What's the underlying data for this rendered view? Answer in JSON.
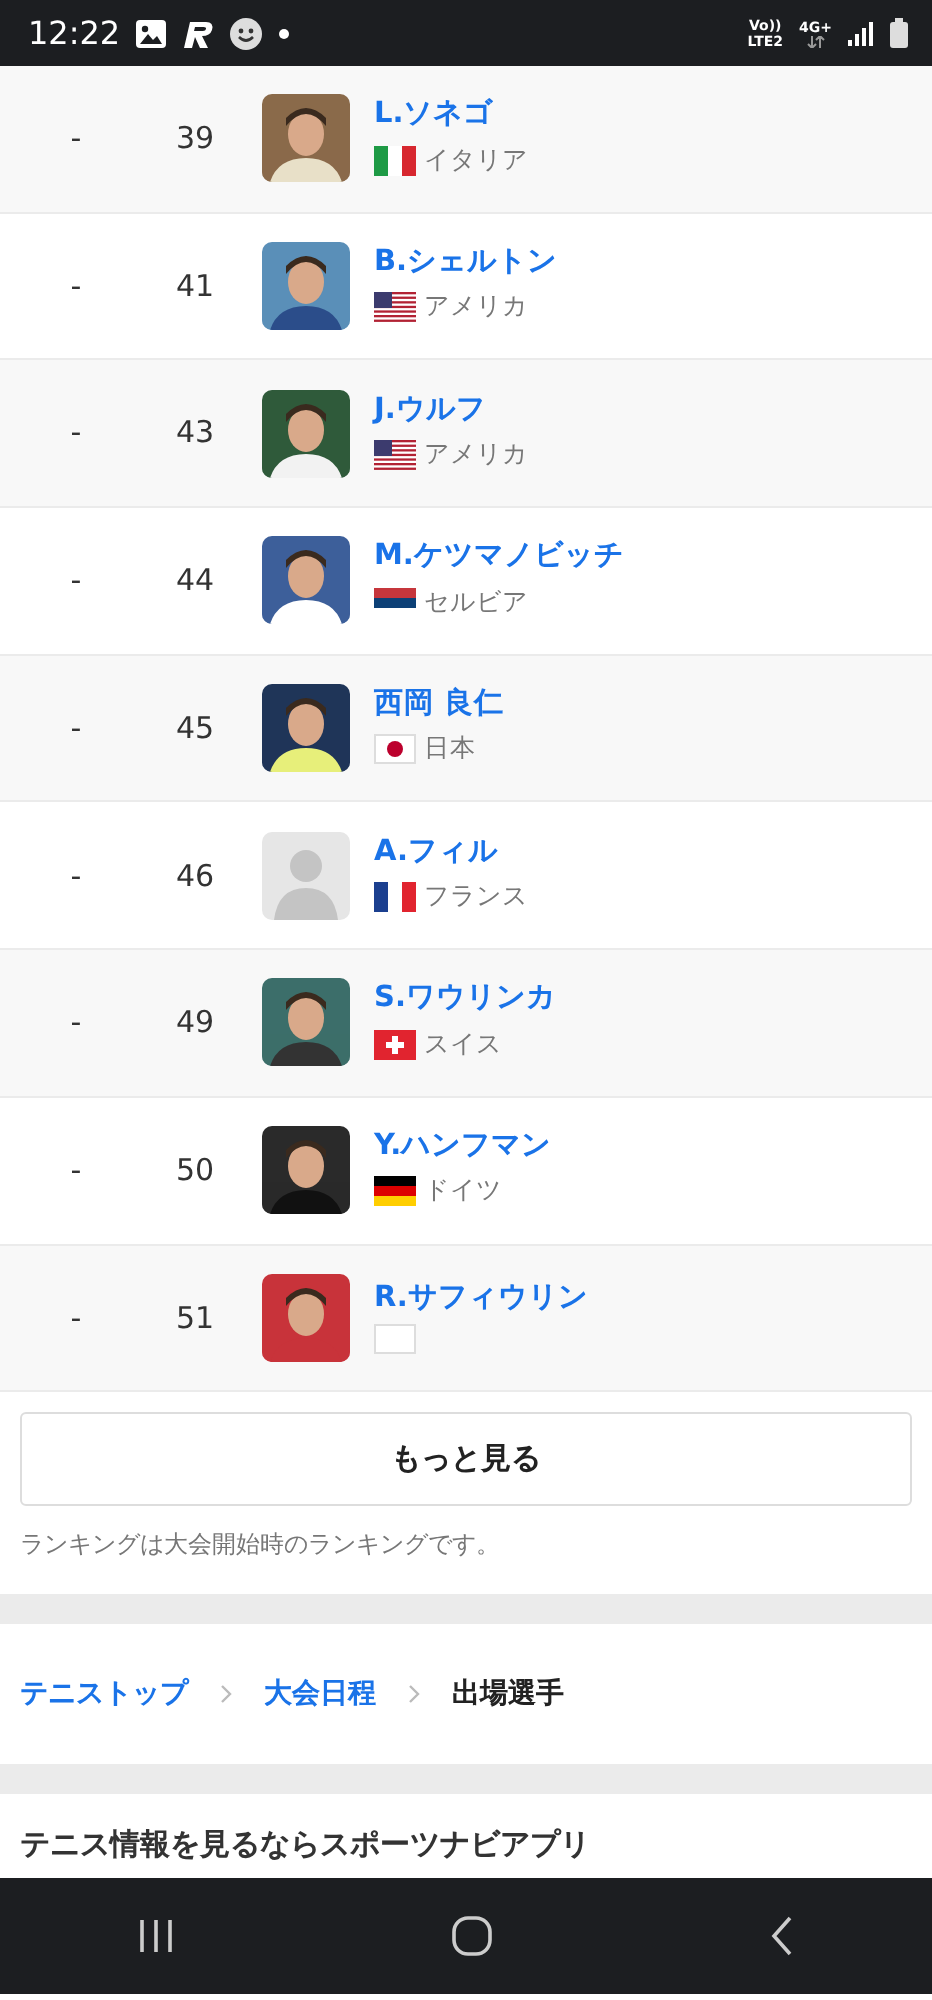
{
  "status_bar": {
    "time": "12:22",
    "volte_top": "Vo))",
    "volte_bottom": "LTE2",
    "network": "4G+"
  },
  "players": [
    {
      "change": "-",
      "rank": "39",
      "name": "L.ソネゴ",
      "country": "イタリア"
    },
    {
      "change": "-",
      "rank": "41",
      "name": "B.シェルトン",
      "country": "アメリカ"
    },
    {
      "change": "-",
      "rank": "43",
      "name": "J.ウルフ",
      "country": "アメリカ"
    },
    {
      "change": "-",
      "rank": "44",
      "name": "M.ケツマノビッチ",
      "country": "セルビア"
    },
    {
      "change": "-",
      "rank": "45",
      "name": "西岡 良仁",
      "country": "日本"
    },
    {
      "change": "-",
      "rank": "46",
      "name": "A.フィル",
      "country": "フランス",
      "photo": {
        "kind": "placeholder"
      }
    },
    {
      "change": "-",
      "rank": "49",
      "name": "S.ワウリンカ",
      "country": "スイス"
    },
    {
      "change": "-",
      "rank": "50",
      "name": "Y.ハンフマン",
      "country": "ドイツ"
    },
    {
      "change": "-",
      "rank": "51",
      "name": "R.サフィウリン"
    }
  ],
  "more_button": "もっと見る",
  "note": "ランキングは大会開始時のランキングです。",
  "breadcrumb": [
    {
      "label": "テニストップ",
      "current": false
    },
    {
      "label": "大会日程",
      "current": false
    },
    {
      "label": "出場選手",
      "current": true
    }
  ],
  "app_banner": "テニス情報を見るならスポーツナビアプリ"
}
